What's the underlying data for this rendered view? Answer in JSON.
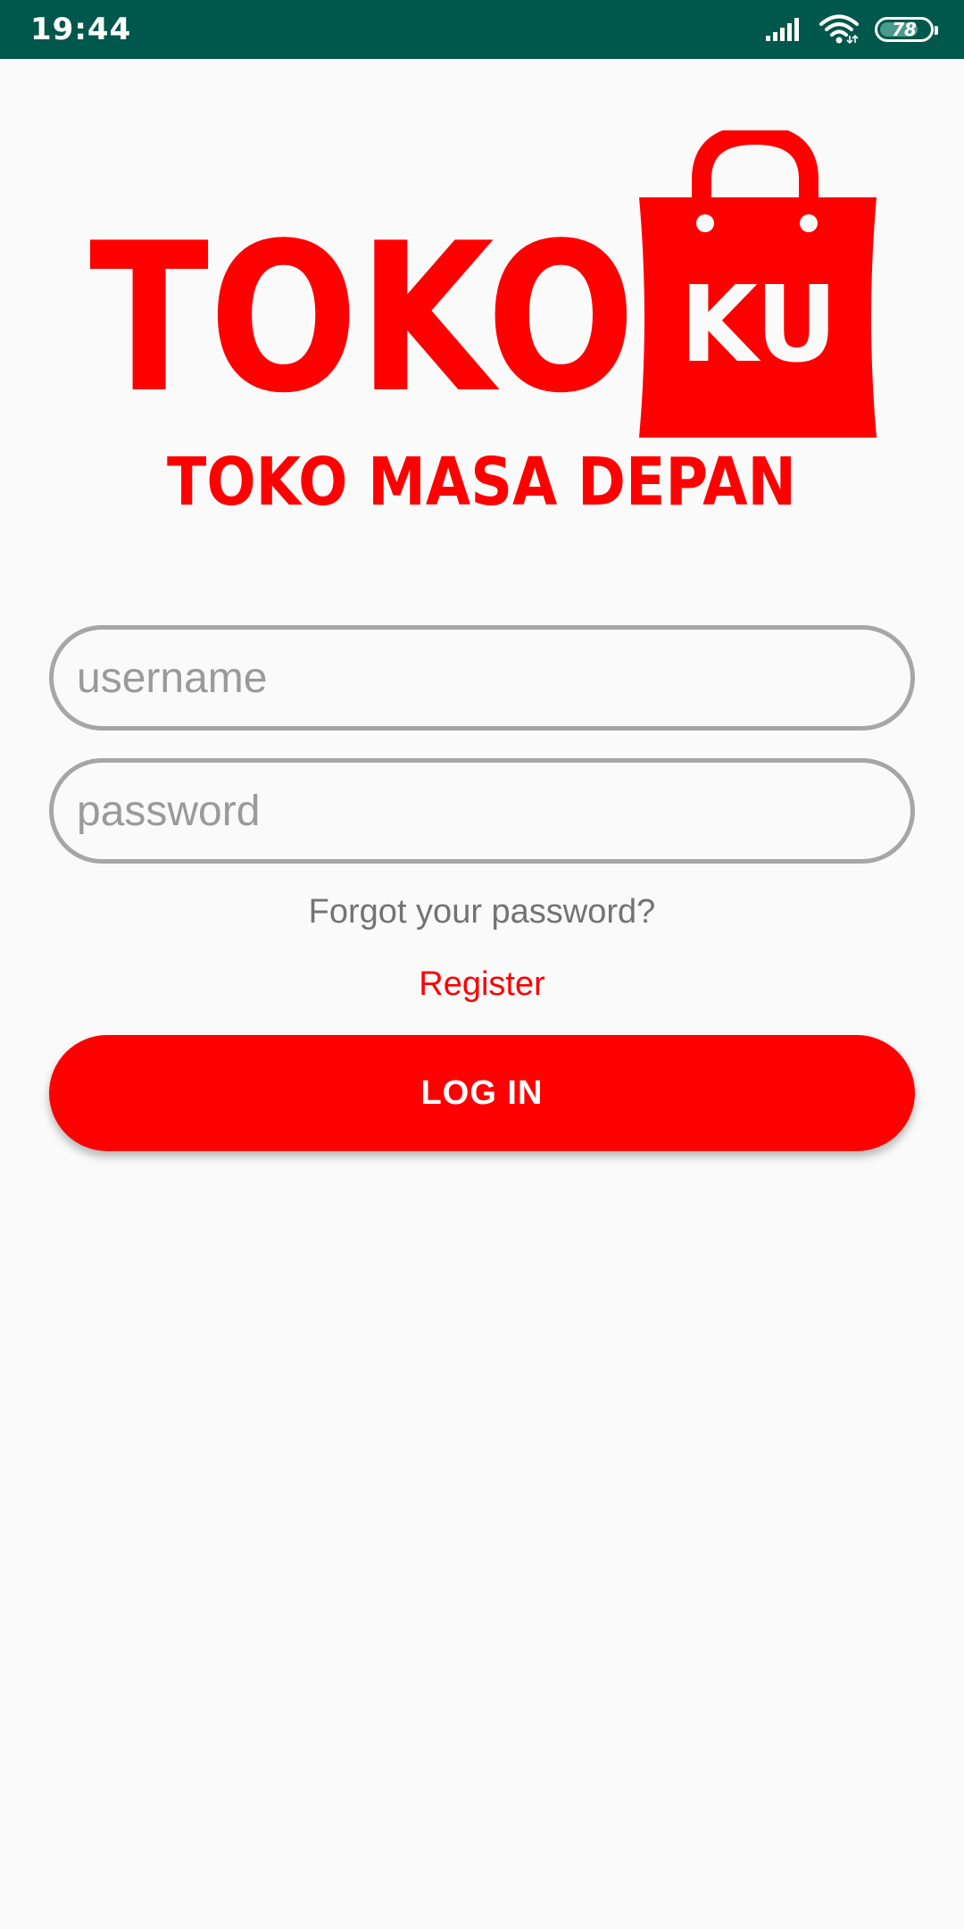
{
  "status_bar": {
    "time": "19:44",
    "battery_level": "78",
    "battery_fraction": 0.78,
    "background_color": "#00574b",
    "icons": [
      "signal-icon",
      "wifi-icon",
      "battery-icon"
    ]
  },
  "logo": {
    "wordmark": "TOKO",
    "bag_text": "KU",
    "tagline": "TOKO MASA DEPAN",
    "color": "#ff0000"
  },
  "form": {
    "username_placeholder": "username",
    "password_placeholder": "password",
    "forgot_password_label": "Forgot your password?",
    "register_label": "Register",
    "login_label": "LOG IN"
  },
  "colors": {
    "accent": "#ff0000",
    "field_border": "#a6a6a6",
    "muted_text": "#737373",
    "background": "#fafafa"
  }
}
